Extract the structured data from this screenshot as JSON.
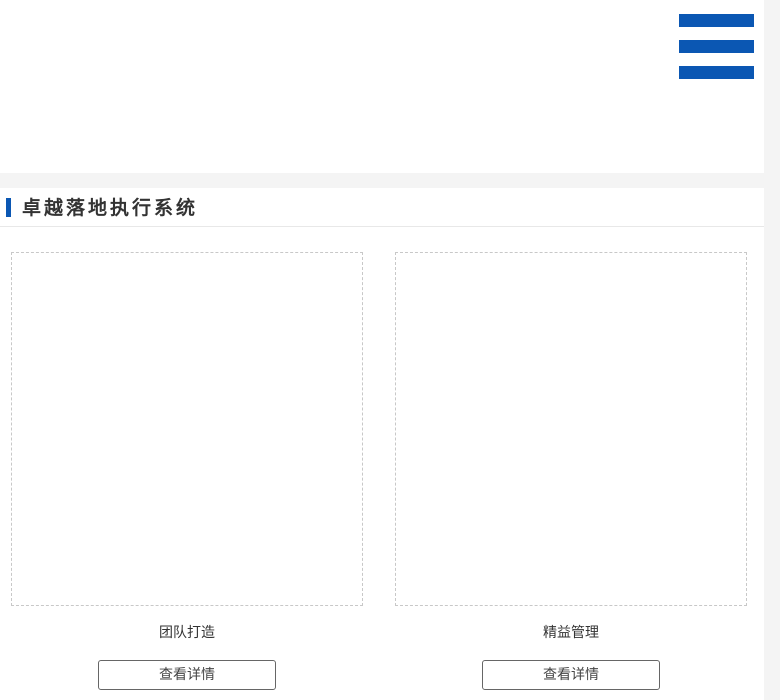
{
  "header": {
    "menu_icon": "hamburger-menu-icon",
    "accent_color": "#0b57b3"
  },
  "section": {
    "title": "卓越落地执行系统"
  },
  "cards": [
    {
      "caption": "团队打造",
      "button_label": "查看详情"
    },
    {
      "caption": "精益管理",
      "button_label": "查看详情"
    }
  ]
}
